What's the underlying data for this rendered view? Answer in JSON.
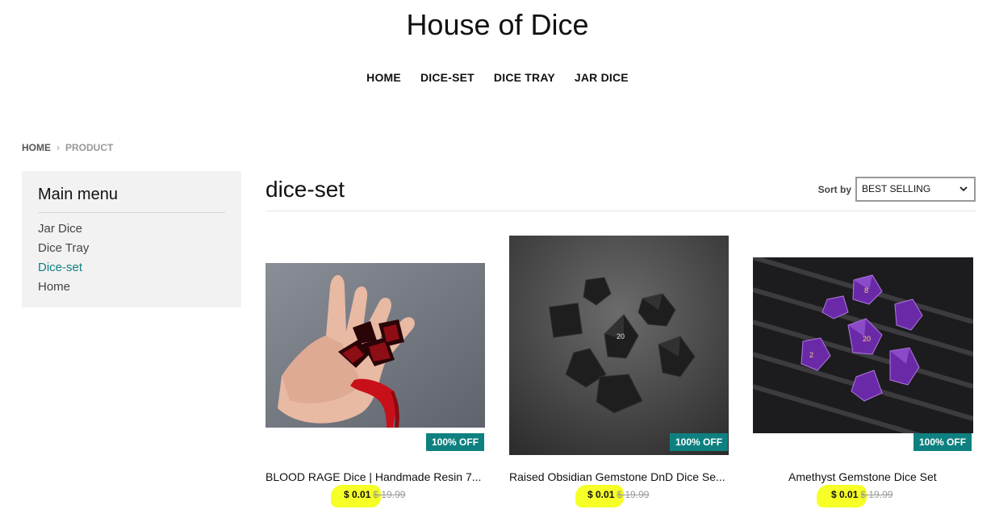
{
  "site": {
    "title": "House of Dice"
  },
  "nav": {
    "items": [
      "HOME",
      "DICE-SET",
      "DICE TRAY",
      "JAR DICE"
    ]
  },
  "breadcrumb": {
    "home": "HOME",
    "separator": "›",
    "current": "PRODUCT"
  },
  "sidebar": {
    "title": "Main menu",
    "items": [
      {
        "label": "Jar Dice"
      },
      {
        "label": "Dice Tray"
      },
      {
        "label": "Dice-set",
        "active": true
      },
      {
        "label": "Home"
      }
    ]
  },
  "collection": {
    "title": "dice-set",
    "sort_label": "Sort by",
    "sort_value": "BEST SELLING"
  },
  "products": [
    {
      "title": "BLOOD RAGE Dice | Handmade Resin 7...",
      "badge": "100% OFF",
      "price": "$ 0.01",
      "compare_price": "$ 19.99"
    },
    {
      "title": "Raised Obsidian Gemstone DnD Dice Se...",
      "badge": "100% OFF",
      "price": "$ 0.01",
      "compare_price": "$ 19.99"
    },
    {
      "title": "Amethyst Gemstone Dice Set",
      "badge": "100% OFF",
      "price": "$ 0.01",
      "compare_price": "$ 19.99"
    }
  ],
  "colors": {
    "accent": "#0f8080",
    "highlight": "#f5ff1a",
    "sidebar_bg": "#f2f2f2"
  }
}
